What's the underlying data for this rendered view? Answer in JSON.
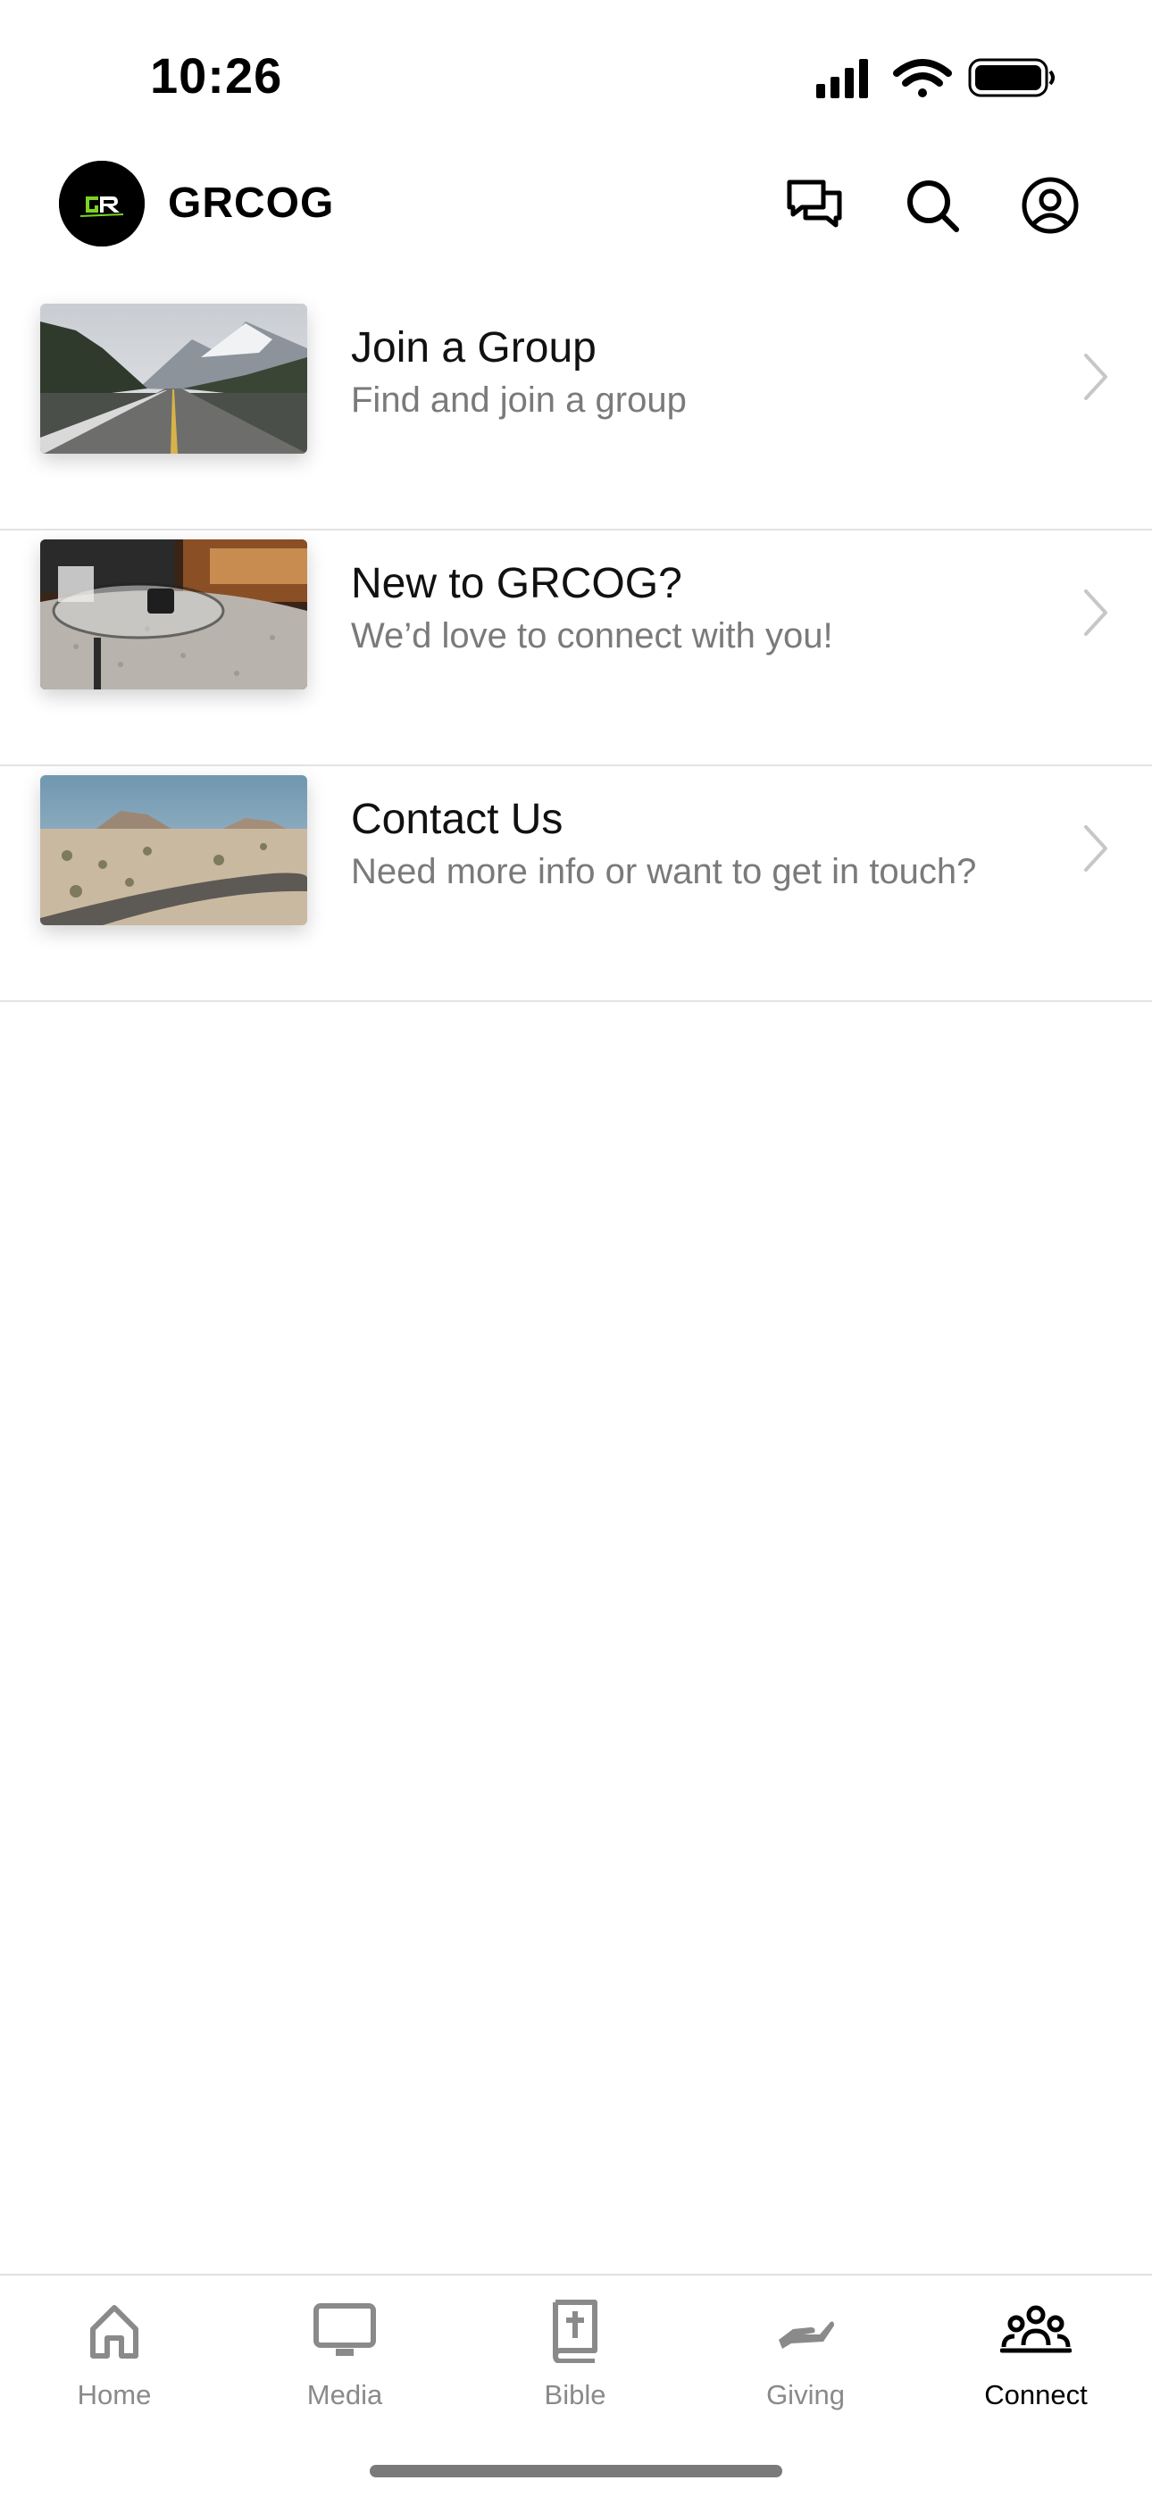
{
  "status_bar": {
    "time": "10:26"
  },
  "header": {
    "title": "GRCOG",
    "logo_text": "GR",
    "actions": [
      {
        "name": "messages-icon"
      },
      {
        "name": "search-icon"
      },
      {
        "name": "account-icon"
      }
    ]
  },
  "list": {
    "items": [
      {
        "title": "Join a Group",
        "subtitle": "Find and join a group"
      },
      {
        "title": "New to GRCOG?",
        "subtitle": "We’d love to connect with you!"
      },
      {
        "title": "Contact Us",
        "subtitle": "Need more info or want to get in touch?"
      }
    ]
  },
  "tabs": [
    {
      "label": "Home",
      "icon": "home-icon",
      "active": false
    },
    {
      "label": "Media",
      "icon": "tv-icon",
      "active": false
    },
    {
      "label": "Bible",
      "icon": "bible-icon",
      "active": false
    },
    {
      "label": "Giving",
      "icon": "giving-hand-icon",
      "active": false
    },
    {
      "label": "Connect",
      "icon": "people-icon",
      "active": true
    }
  ],
  "colors": {
    "accent_green": "#7ED321",
    "subtitle_gray": "#7a7a7a",
    "tab_inactive": "#8a8a8a",
    "divider": "#e3e3e3"
  }
}
